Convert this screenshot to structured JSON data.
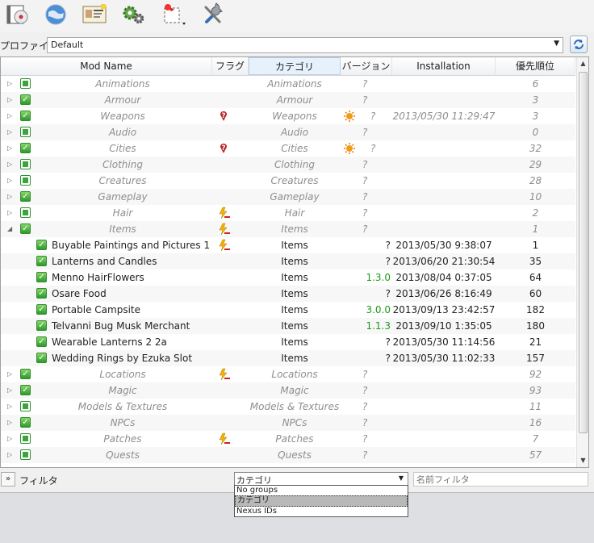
{
  "toolbar": {
    "buttons": [
      {
        "name": "install-disk-icon"
      },
      {
        "name": "globe-icon"
      },
      {
        "name": "profile-card-icon"
      },
      {
        "name": "gears-icon"
      },
      {
        "name": "tools-menu-icon"
      },
      {
        "name": "wrench-screwdriver-icon"
      }
    ]
  },
  "profile": {
    "label": "プロファイル",
    "value": "Default"
  },
  "columns": {
    "mod_name": "Mod Name",
    "flag": "フラグ",
    "category": "カテゴリ",
    "version": "バージョン",
    "installation": "Installation",
    "priority": "優先順位"
  },
  "rows": [
    {
      "type": "group",
      "expanded": false,
      "checked": "partial",
      "name": "Animations",
      "category": "Animations",
      "version": "?",
      "priority": "6"
    },
    {
      "type": "group",
      "expanded": false,
      "checked": "full",
      "name": "Armour",
      "category": "Armour",
      "version": "?",
      "priority": "3"
    },
    {
      "type": "group",
      "expanded": false,
      "checked": "full",
      "name": "Weapons",
      "category": "Weapons",
      "flag": "alert",
      "vflag": "sun",
      "version": "?",
      "installation": "2013/05/30 11:29:47",
      "priority": "3"
    },
    {
      "type": "group",
      "expanded": false,
      "checked": "partial",
      "name": "Audio",
      "category": "Audio",
      "version": "?",
      "priority": "0"
    },
    {
      "type": "group",
      "expanded": false,
      "checked": "full",
      "name": "Cities",
      "category": "Cities",
      "flag": "alert",
      "vflag": "sun",
      "version": "?",
      "priority": "32"
    },
    {
      "type": "group",
      "expanded": false,
      "checked": "partial",
      "name": "Clothing",
      "category": "Clothing",
      "version": "?",
      "priority": "29"
    },
    {
      "type": "group",
      "expanded": false,
      "checked": "partial",
      "name": "Creatures",
      "category": "Creatures",
      "version": "?",
      "priority": "28"
    },
    {
      "type": "group",
      "expanded": false,
      "checked": "full",
      "name": "Gameplay",
      "category": "Gameplay",
      "version": "?",
      "priority": "10"
    },
    {
      "type": "group",
      "expanded": false,
      "checked": "partial",
      "name": "Hair",
      "category": "Hair",
      "flag": "bolt",
      "version": "?",
      "priority": "2"
    },
    {
      "type": "group",
      "expanded": true,
      "checked": "full",
      "name": "Items",
      "category": "Items",
      "flag": "bolt",
      "version": "?",
      "priority": "1"
    },
    {
      "type": "mod",
      "checked": "full",
      "name": "Buyable Paintings and Pictures 1",
      "category": "Items",
      "flag": "bolt",
      "version": "?",
      "installation": "2013/05/30 9:38:07",
      "priority": "1"
    },
    {
      "type": "mod",
      "checked": "full",
      "name": "Lanterns and Candles",
      "category": "Items",
      "version": "?",
      "installation": "2013/06/20 21:30:54",
      "priority": "35"
    },
    {
      "type": "mod",
      "checked": "full",
      "name": "Menno HairFlowers",
      "category": "Items",
      "version": "1.3.0",
      "vgreen": true,
      "installation": "2013/08/04 0:37:05",
      "priority": "64"
    },
    {
      "type": "mod",
      "checked": "full",
      "name": "Osare Food",
      "category": "Items",
      "version": "?",
      "installation": "2013/06/26 8:16:49",
      "priority": "60"
    },
    {
      "type": "mod",
      "checked": "full",
      "name": "Portable Campsite",
      "category": "Items",
      "version": "3.0.0",
      "vgreen": true,
      "installation": "2013/09/13 23:42:57",
      "priority": "182"
    },
    {
      "type": "mod",
      "checked": "full",
      "name": "Telvanni Bug Musk Merchant",
      "category": "Items",
      "version": "1.1.3",
      "vgreen": true,
      "installation": "2013/09/10 1:35:05",
      "priority": "180"
    },
    {
      "type": "mod",
      "checked": "full",
      "name": "Wearable Lanterns 2 2a",
      "category": "Items",
      "version": "?",
      "installation": "2013/05/30 11:14:56",
      "priority": "21"
    },
    {
      "type": "mod",
      "checked": "full",
      "name": "Wedding Rings by Ezuka Slot",
      "category": "Items",
      "version": "?",
      "installation": "2013/05/30 11:02:33",
      "priority": "157"
    },
    {
      "type": "group",
      "expanded": false,
      "checked": "full",
      "name": "Locations",
      "category": "Locations",
      "flag": "bolt",
      "version": "?",
      "priority": "92"
    },
    {
      "type": "group",
      "expanded": false,
      "checked": "full",
      "name": "Magic",
      "category": "Magic",
      "version": "?",
      "priority": "93"
    },
    {
      "type": "group",
      "expanded": false,
      "checked": "partial",
      "name": "Models & Textures",
      "category": "Models & Textures",
      "version": "?",
      "priority": "11"
    },
    {
      "type": "group",
      "expanded": false,
      "checked": "full",
      "name": "NPCs",
      "category": "NPCs",
      "version": "?",
      "priority": "16"
    },
    {
      "type": "group",
      "expanded": false,
      "checked": "partial",
      "name": "Patches",
      "category": "Patches",
      "flag": "bolt",
      "version": "?",
      "priority": "7"
    },
    {
      "type": "group",
      "expanded": false,
      "checked": "partial",
      "name": "Quests",
      "category": "Quests",
      "version": "?",
      "priority": "57"
    }
  ],
  "bottom": {
    "toggle": "»",
    "filter_label": "フィルタ",
    "group_select": "カテゴリ",
    "name_filter_placeholder": "名前フィルタ"
  },
  "dropdown": {
    "options": [
      "No groups",
      "カテゴリ",
      "Nexus IDs"
    ],
    "selected_index": 1
  }
}
